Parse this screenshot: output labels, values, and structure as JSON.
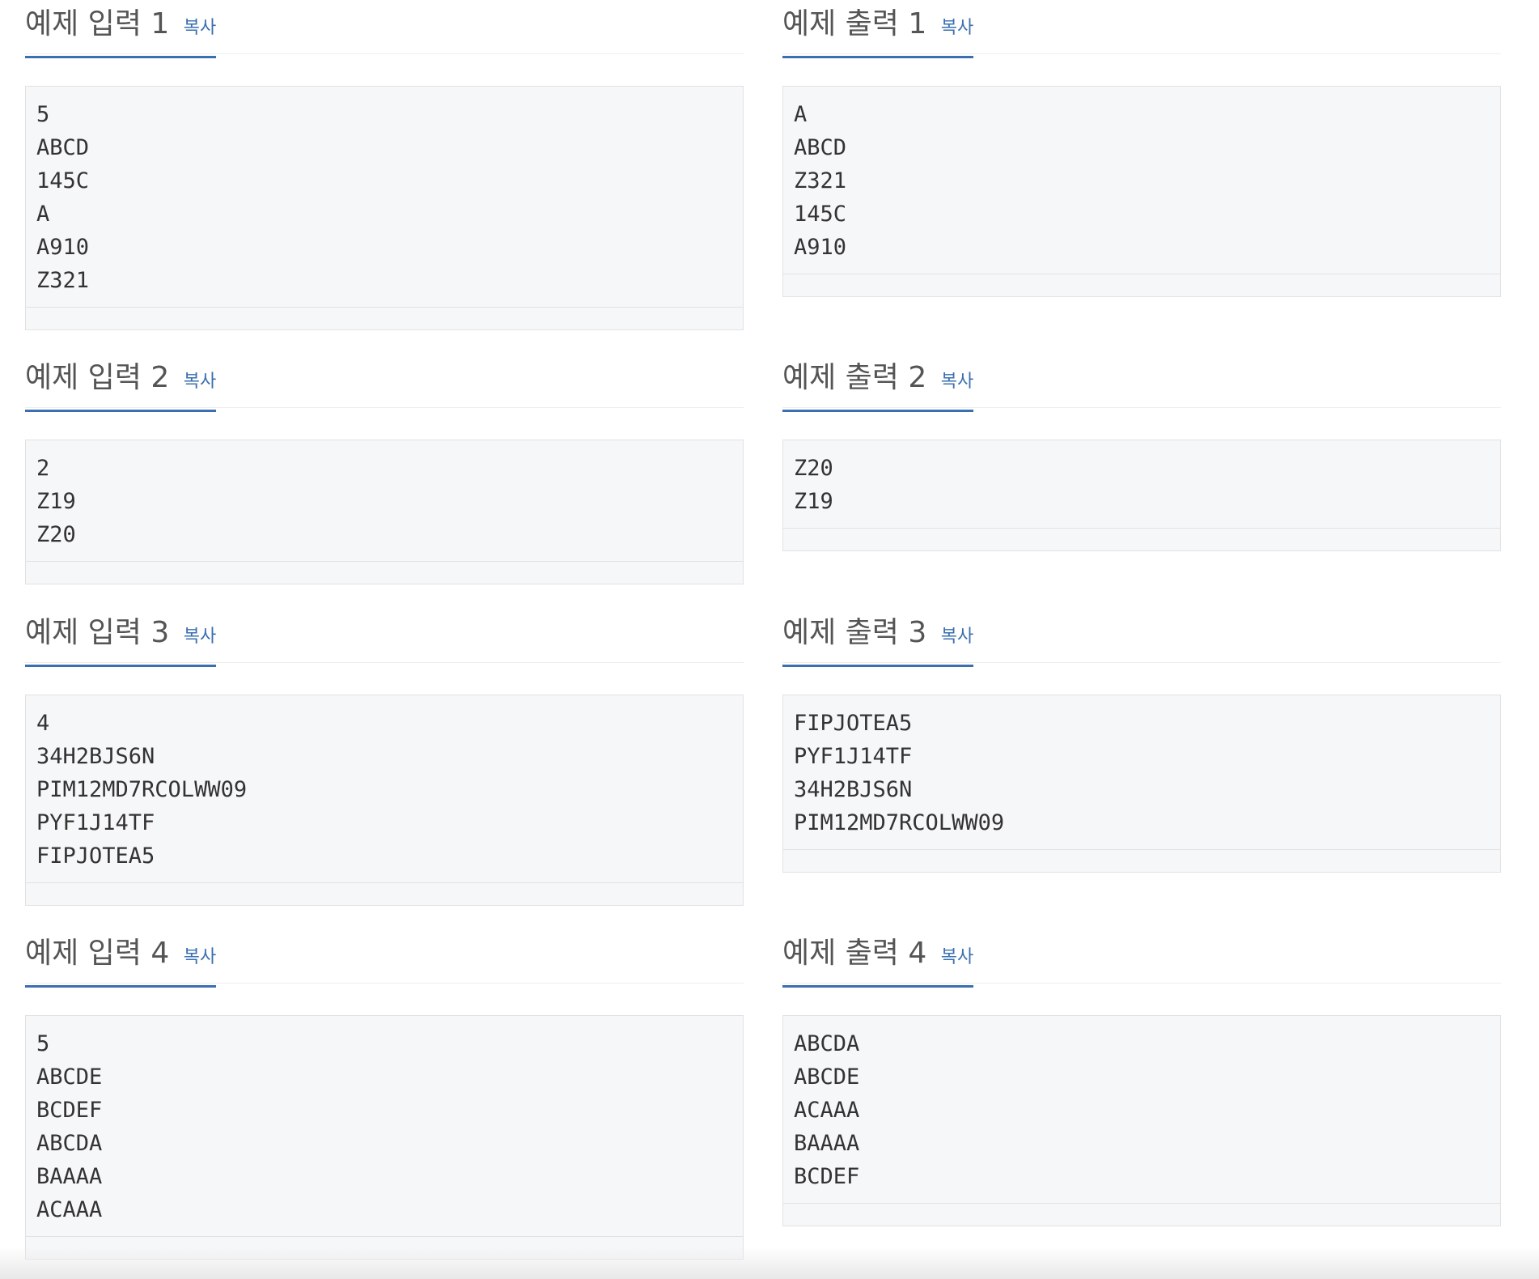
{
  "copy_label": "복사",
  "samples": [
    {
      "input": {
        "title": "예제 입력 1",
        "text": "5\nABCD\n145C\nA\nA910\nZ321"
      },
      "output": {
        "title": "예제 출력 1",
        "text": "A\nABCD\nZ321\n145C\nA910"
      }
    },
    {
      "input": {
        "title": "예제 입력 2",
        "text": "2\nZ19\nZ20"
      },
      "output": {
        "title": "예제 출력 2",
        "text": "Z20\nZ19"
      }
    },
    {
      "input": {
        "title": "예제 입력 3",
        "text": "4\n34H2BJS6N\nPIM12MD7RCOLWW09\nPYF1J14TF\nFIPJOTEA5"
      },
      "output": {
        "title": "예제 출력 3",
        "text": "FIPJOTEA5\nPYF1J14TF\n34H2BJS6N\nPIM12MD7RCOLWW09"
      }
    },
    {
      "input": {
        "title": "예제 입력 4",
        "text": "5\nABCDE\nBCDEF\nABCDA\nBAAAA\nACAAA"
      },
      "output": {
        "title": "예제 출력 4",
        "text": "ABCDA\nABCDE\nACAAA\nBAAAA\nBCDEF"
      }
    }
  ]
}
